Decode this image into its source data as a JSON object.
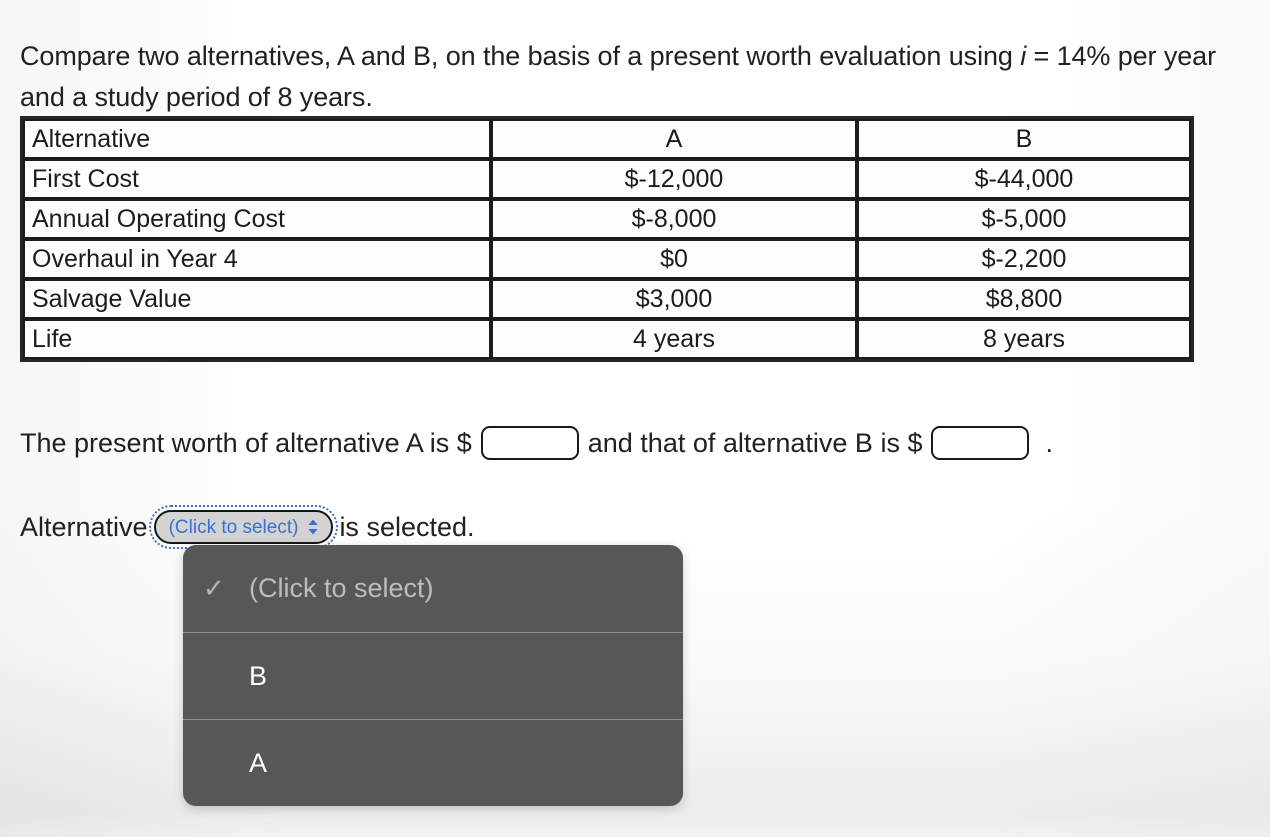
{
  "question": {
    "text_before_i": "Compare two alternatives, A and B, on the basis of a present worth evaluation using ",
    "italic_symbol": "i",
    "text_after_i": " = 14% per year and a study period of 8 years."
  },
  "table": {
    "headers": [
      "Alternative",
      "A",
      "B"
    ],
    "rows": [
      {
        "label": "First Cost",
        "a": "$-12,000",
        "b": "$-44,000"
      },
      {
        "label": "Annual Operating Cost",
        "a": "$-8,000",
        "b": "$-5,000"
      },
      {
        "label": "Overhaul in Year 4",
        "a": "$0",
        "b": "$-2,200"
      },
      {
        "label": "Salvage Value",
        "a": "$3,000",
        "b": "$8,800"
      },
      {
        "label": "Life",
        "a": "4 years",
        "b": "8 years"
      }
    ]
  },
  "answer_line": {
    "part1": "The present worth of alternative A is $",
    "input_a_value": "",
    "input_a_placeholder": "",
    "part2": "and that of alternative B is $",
    "input_b_value": "",
    "input_b_placeholder": "",
    "period": "."
  },
  "select_line": {
    "prefix": "Alternative",
    "selected_label": "(Click to select)",
    "chevron_icon": "chevron-up-down-icon",
    "suffix": "is selected."
  },
  "dropdown": {
    "check_glyph": "✓",
    "options": [
      {
        "label": "(Click to select)",
        "checked": true,
        "placeholder": true
      },
      {
        "label": "B",
        "checked": false,
        "placeholder": false
      },
      {
        "label": "A",
        "checked": false,
        "placeholder": false
      }
    ]
  },
  "colors": {
    "accent_blue": "#3b6fd4",
    "dropdown_bg": "#575757",
    "dropdown_divider": "#8e8e8e",
    "placeholder_text": "#bdbdbd",
    "select_fill": "#d3d3d3",
    "border_black": "#1a1a1a",
    "page_bg": "#ffffff"
  }
}
